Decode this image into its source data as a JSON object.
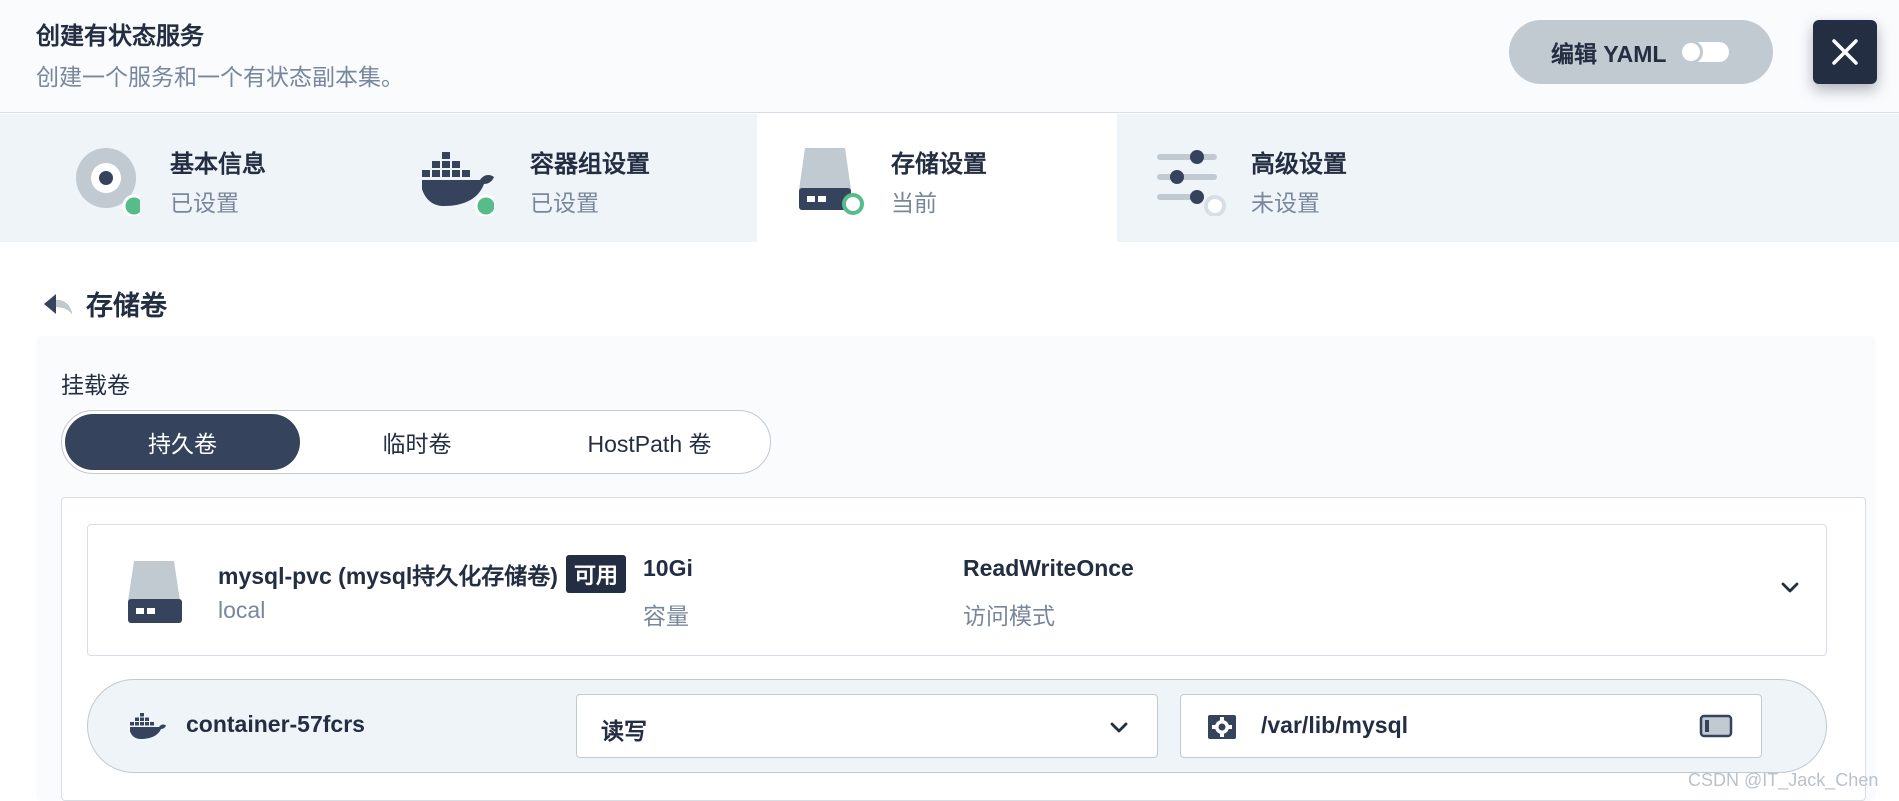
{
  "header": {
    "title": "创建有状态服务",
    "subtitle": "创建一个服务和一个有状态副本集。",
    "yaml_label": "编辑 YAML"
  },
  "steps": [
    {
      "name": "基本信息",
      "state": "已设置",
      "icon": "disc-icon",
      "status_color": "#55bc8a"
    },
    {
      "name": "容器组设置",
      "state": "已设置",
      "icon": "docker-whale-icon",
      "status_color": "#55bc8a"
    },
    {
      "name": "存储设置",
      "state": "当前",
      "icon": "hard-drive-icon",
      "status_color": "#55bc8a"
    },
    {
      "name": "高级设置",
      "state": "未设置",
      "icon": "sliders-icon",
      "status_color": "#d8dee5"
    }
  ],
  "section": {
    "title": "存储卷"
  },
  "mount": {
    "label": "挂载卷",
    "tabs": [
      "持久卷",
      "临时卷",
      "HostPath 卷"
    ],
    "selected_tab": "持久卷"
  },
  "volume": {
    "name": "mysql-pvc (mysql持久化存储卷)",
    "status": "可用",
    "storage_class": "local",
    "capacity": "10Gi",
    "capacity_label": "容量",
    "access_mode": "ReadWriteOnce",
    "access_mode_label": "访问模式"
  },
  "container_mount": {
    "container": "container-57fcrs",
    "mode": "读写",
    "path": "/var/lib/mysql"
  },
  "watermark": "CSDN @IT_Jack_Chen",
  "colors": {
    "primary_dark": "#242e42",
    "success": "#55bc8a",
    "muted_text": "#79879c",
    "border": "#c1c9d1"
  }
}
